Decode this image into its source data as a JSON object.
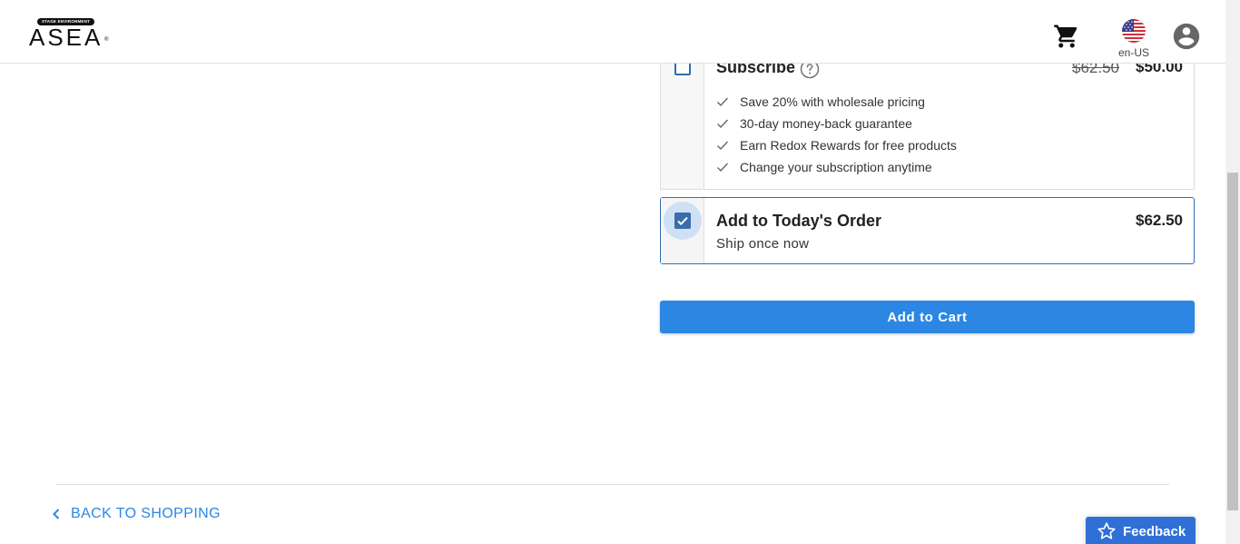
{
  "header": {
    "logo_tag": "STAGE ENVIRONMENT",
    "logo_text": "ASEA",
    "logo_mark": "®",
    "cart_icon": "shopping-cart-icon",
    "flag_icon": "us-flag-icon",
    "locale": "en-US",
    "account_icon": "account-circle-icon"
  },
  "subscribe": {
    "title": "Subscribe",
    "help_icon": "question-circle-icon",
    "price_original": "$62.50",
    "price": "$50.00",
    "checked": false,
    "benefits": [
      "Save 20% with wholesale pricing",
      "30-day money-back guarantee",
      "Earn Redox Rewards for free products",
      "Change your subscription anytime"
    ]
  },
  "today_order": {
    "title": "Add to Today's Order",
    "subtitle": "Ship once now",
    "price": "$62.50",
    "checked": true
  },
  "actions": {
    "add_to_cart": "Add to Cart",
    "back_to_shopping": "BACK TO SHOPPING",
    "feedback": "Feedback"
  },
  "colors": {
    "primary": "#2b87e3",
    "selected_border": "#2f6fb3",
    "feedback_bg": "#2f6fd6"
  }
}
